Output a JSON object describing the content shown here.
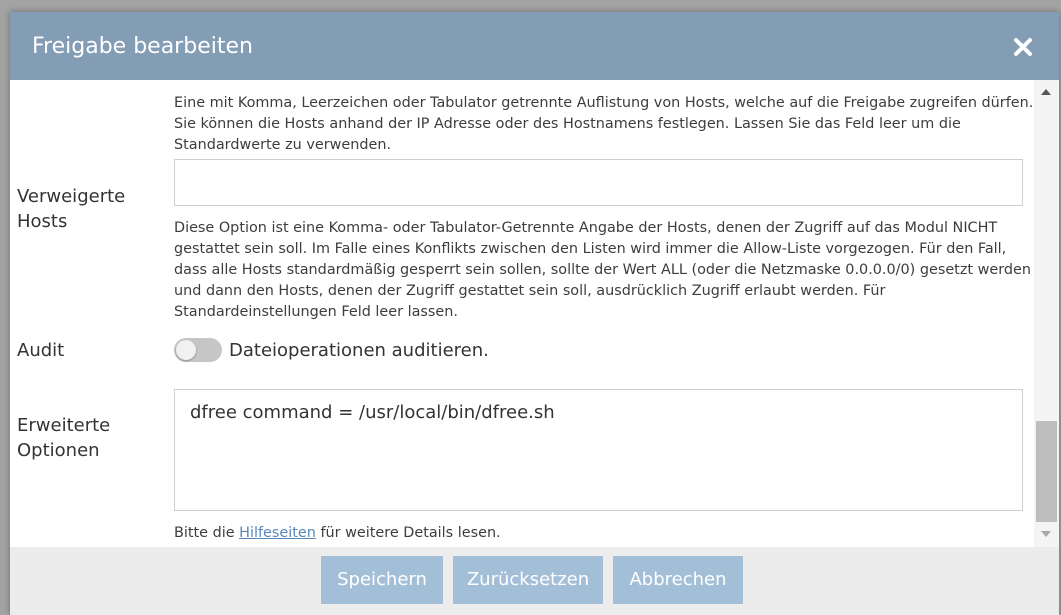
{
  "dialog": {
    "title": "Freigabe bearbeiten",
    "close_icon": "close-icon"
  },
  "form": {
    "allowed_hosts_help": "Eine mit Komma, Leerzeichen oder Tabulator getrennte Auflistung von Hosts, welche auf die Freigabe zugreifen dürfen. Sie können die Hosts anhand der IP Adresse oder des Hostnamens festlegen. Lassen Sie das Feld leer um die Standardwerte zu verwenden.",
    "denied_hosts_label": "Verweigerte Hosts",
    "denied_hosts_value": "",
    "denied_hosts_help": "Diese Option ist eine Komma- oder Tabulator-Getrennte Angabe der Hosts, denen der Zugriff auf das Modul NICHT gestattet sein soll. Im Falle eines Konflikts zwischen den Listen wird immer die Allow-Liste vorgezogen. Für den Fall, dass alle Hosts standardmäßig gesperrt sein sollen, sollte der Wert ALL (oder die Netzmaske 0.0.0.0/0) gesetzt werden und dann den Hosts, denen der Zugriff gestattet sein soll, ausdrücklich Zugriff erlaubt werden. Für Standardeinstellungen Feld leer lassen.",
    "audit_label": "Audit",
    "audit_toggle_label": "Dateioperationen auditieren.",
    "audit_enabled": false,
    "extra_options_label": "Erweiterte Optionen",
    "extra_options_value": "dfree command = /usr/local/bin/dfree.sh",
    "extra_options_help_prefix": "Bitte die ",
    "extra_options_help_link": "Hilfeseiten",
    "extra_options_help_suffix": " für weitere Details lesen."
  },
  "footer": {
    "save_label": "Speichern",
    "reset_label": "Zurücksetzen",
    "cancel_label": "Abbrechen"
  },
  "colors": {
    "titlebar": "#839db4",
    "button": "#a3bfd8",
    "link": "#5a88b8"
  }
}
